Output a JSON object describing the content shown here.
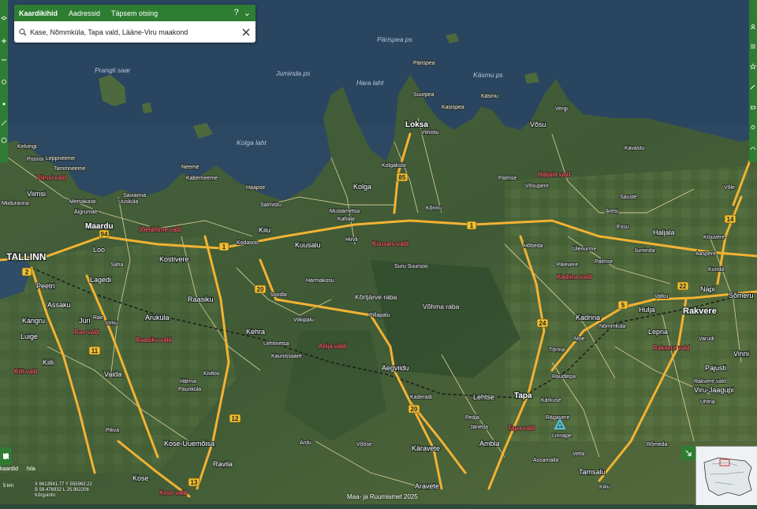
{
  "search": {
    "tabs": [
      "Kaardikihid",
      "Aadressid",
      "Täpsem otsing"
    ],
    "help_symbol": "?",
    "collapse_symbol": "⌄",
    "query": "Kase, Nõmmküla, Tapa vald, Lääne-Viru maakond"
  },
  "map": {
    "cities": [
      "TALLINN",
      "Maardu",
      "Rakvere",
      "Tapa",
      "Loksa"
    ],
    "towns": [
      "Viimsi",
      "Loo",
      "Kostivere",
      "Lagedi",
      "Peetri",
      "Assaku",
      "Jüri",
      "Raasiku",
      "Aruküla",
      "Kehra",
      "Kiili",
      "Luige",
      "Kangru",
      "Vaida",
      "Kuusalu",
      "Kiiu",
      "Kolga",
      "Aegviidu",
      "Kose-Uuemõisa",
      "Ravila",
      "Kose",
      "Lehtse",
      "Ambla",
      "Käravete",
      "Aravete",
      "Tamsalu",
      "Kadrina",
      "Hulja",
      "Lepna",
      "Haljala",
      "Võsu",
      "Napi",
      "Sõmeru",
      "Vinni",
      "Pajusti",
      "Viru-Jaagupi"
    ],
    "villages": [
      "Kelvingi",
      "Püünsi",
      "Leppneeme",
      "Tammneeme",
      "Pringi",
      "Miiduranna",
      "Metsakasti",
      "Äigrumäe",
      "Savianna",
      "Uusküla",
      "Kallavere",
      "Neeme",
      "Kaberneeme",
      "Saha",
      "Iru",
      "Haapse",
      "Salmistu",
      "Valkla",
      "Kodasoo",
      "Sauruse",
      "Mustametsa",
      "Kahala",
      "Kolgaküla",
      "Viinistu",
      "Pärispea",
      "Suurpea",
      "Kasispea",
      "Käsmu",
      "Vergi",
      "Palmse",
      "Võsupere",
      "Hirvli",
      "Kõnnu",
      "Harmakosu",
      "Suru Suursoo",
      "Soodla",
      "Pillapalu",
      "Viikipalu",
      "Kaunissaare",
      "Lehtmetsa",
      "Ülejõe",
      "Kiviloo",
      "Härma",
      "Paunküla",
      "Vaskjala",
      "Rae",
      "Limu",
      "Saku",
      "Vilivalla",
      "Vaela",
      "Kuusiku",
      "Tuhala",
      "Pikva",
      "Saula",
      "Oru",
      "Kolu",
      "Palvere",
      "Ardu",
      "Võõse",
      "Kaderadi",
      "Pedja",
      "Jäneda",
      "Rägavere",
      "Linnape",
      "Nõmmküla",
      "Kärkuse",
      "Tõrma",
      "Moe",
      "Raudlepa",
      "Vetla",
      "Ilmaste",
      "Assamalla",
      "Kiku",
      "Rõmeda",
      "Kuie",
      "Kupu",
      "Võhma",
      "Rakvere vald",
      "Uhtna",
      "Varudi",
      "Levala",
      "Pikevere",
      "Ülenurme",
      "Hõbeda",
      "Aaspere",
      "Juminda",
      "Põdruse",
      "Kisuvere",
      "Kunda",
      "Essu",
      "Aresi",
      "Sauste",
      "Kavastu",
      "Annikvere",
      "Vihula",
      "Lahe",
      "Palmse",
      "Vatku",
      "Võle",
      "Tõrremäe",
      "Ubja"
    ],
    "water_labels": [
      "Prangli saar",
      "Juminda ps",
      "Hara laht",
      "Pärispea ps",
      "Käsmu ps",
      "Kolga laht",
      "Võhma raba",
      "Laiuse raba",
      "Kõrtjärve raba",
      "Liiba raba"
    ],
    "parishes": [
      "Viimsi vald",
      "Jõelähtme vald",
      "Rae vald",
      "Raasiku vald",
      "Kiili vald",
      "Kuusalu vald",
      "Anija vald",
      "Kose vald",
      "Haljala vald",
      "Kadrina vald",
      "Rakvere vald",
      "Tapa vald"
    ],
    "road_numbers": [
      "1",
      "5",
      "11",
      "12",
      "13",
      "14",
      "20",
      "21",
      "22",
      "24",
      "85",
      "94",
      "2"
    ],
    "colors": {
      "major_road": "#f2b233",
      "minor_road": "#e8d9a0",
      "water": "#2f4a64",
      "forest": "#3e5a34",
      "parish_label": "#ff6f6f"
    }
  },
  "footer": {
    "coords_line1": "X 6613941.77 Y 555963.22",
    "coords_line2": "B 59.476932  L 25.992206",
    "coords_line3": "Kõrguinfo:",
    "scale_label": "5 km",
    "attribution": "Maa- ja Ruumiamet 2025",
    "basemap_label": "kaardid",
    "hybrid_label": "hila"
  },
  "icons": {
    "left_rail": [
      "layers-icon",
      "plus-icon",
      "minus-icon",
      "share-icon",
      "location-icon",
      "measure-icon",
      "info-icon"
    ],
    "right_rail": [
      "user-icon",
      "list-icon",
      "star-icon",
      "draw-icon",
      "print-icon",
      "marker-icon",
      "route-icon"
    ],
    "search": "search-icon",
    "clear": "close-icon",
    "map_pin": "location-pin-icon",
    "overview_toggle": "expand-icon"
  }
}
